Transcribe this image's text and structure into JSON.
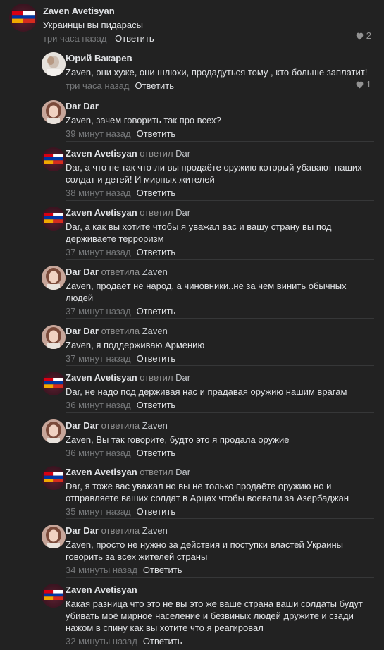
{
  "root_comment": {
    "author": "Zaven Avetisyan",
    "text": "Украинцы вы пидарасы",
    "time": "три часа назад",
    "reply_label": "Ответить",
    "likes": "2"
  },
  "replies": [
    {
      "author": "Юрий Вакарев",
      "reply_word": "",
      "target": "",
      "text": "Zaven, они хуже, они шлюхи, продадуться тому , кто больше заплатит!",
      "time": "три часа назад",
      "reply_label": "Ответить",
      "likes": "1"
    },
    {
      "author": "Dar Dar",
      "reply_word": "",
      "target": "",
      "text": "Zaven, зачем говорить так про всех?",
      "time": "39 минут назад",
      "reply_label": "Ответить"
    },
    {
      "author": "Zaven Avetisyan",
      "reply_word": "ответил",
      "target": "Dar",
      "text": "Dar, а что не так что-ли вы продаёте оружию который убавают наших солдат и детей! И мирных жителей",
      "time": "38 минут назад",
      "reply_label": "Ответить"
    },
    {
      "author": "Zaven Avetisyan",
      "reply_word": "ответил",
      "target": "Dar",
      "text": "Dar, а как вы хотите чтобы я уважал вас и вашу страну вы под держиваете терроризм",
      "time": "37 минут назад",
      "reply_label": "Ответить"
    },
    {
      "author": "Dar Dar",
      "reply_word": "ответила",
      "target": "Zaven",
      "text": "Zaven, продаёт не народ, а чиновники..не за чем винить обычных людей",
      "time": "37 минут назад",
      "reply_label": "Ответить"
    },
    {
      "author": "Dar Dar",
      "reply_word": "ответила",
      "target": "Zaven",
      "text": "Zaven, я поддерживаю Армению",
      "time": "37 минут назад",
      "reply_label": "Ответить"
    },
    {
      "author": "Zaven Avetisyan",
      "reply_word": "ответил",
      "target": "Dar",
      "text": "Dar, не надо под держивая нас и прадавая оружию нашим врагам",
      "time": "36 минут назад",
      "reply_label": "Ответить"
    },
    {
      "author": "Dar Dar",
      "reply_word": "ответила",
      "target": "Zaven",
      "text": "Zaven, Вы так говорите, будто это я продала оружие",
      "time": "36 минут назад",
      "reply_label": "Ответить"
    },
    {
      "author": "Zaven Avetisyan",
      "reply_word": "ответил",
      "target": "Dar",
      "text": "Dar, я тоже вас уважал но вы не только продаёте оружию но и отправляете ваших солдат в Арцах чтобы воевали за Азербаджан",
      "time": "35 минут назад",
      "reply_label": "Ответить"
    },
    {
      "author": "Dar Dar",
      "reply_word": "ответила",
      "target": "Zaven",
      "text": "Zaven, просто не нужно за действия и поступки властей Украины говорить за всех жителей страны",
      "time": "34 минуты назад",
      "reply_label": "Ответить"
    },
    {
      "author": "Zaven Avetisyan",
      "reply_word": "",
      "target": "",
      "text": "Какая разница что это не вы это же ваше страна ваши солдаты будут убивать моё мирное население и безвиных людей дружите и сзади нажом в спину как вы хотите что я реагировал",
      "time": "32 минуты назад",
      "reply_label": "Ответить"
    }
  ]
}
